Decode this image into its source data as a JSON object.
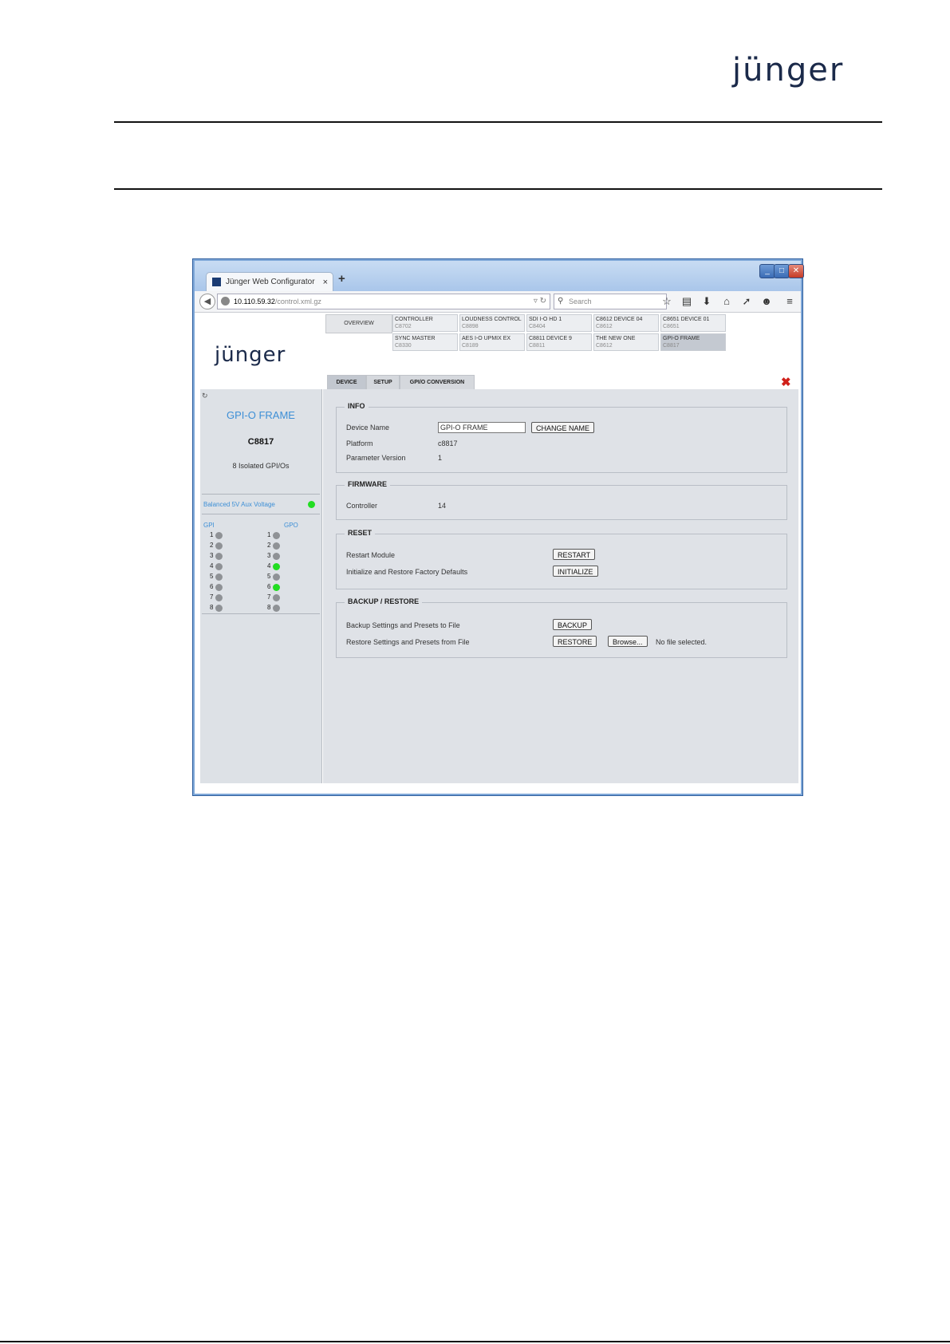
{
  "document": {
    "logo_text": "jünger"
  },
  "browser": {
    "tab_title": "Jünger Web Configurator",
    "tab_close": "×",
    "new_tab": "+",
    "url_host": "10.110.59.32",
    "url_path": "/control.xml.gz",
    "search_placeholder": "Search"
  },
  "app": {
    "logo_text": "jünger",
    "overview_label": "OVERVIEW",
    "devices": [
      {
        "name": "CONTROLLER",
        "code": "C8702"
      },
      {
        "name": "LOUDNESS CONTROL",
        "code": "C8898"
      },
      {
        "name": "SDI I-O HD 1",
        "code": "C8404"
      },
      {
        "name": "C8612 DEVICE 04",
        "code": "C8612"
      },
      {
        "name": "C8651 DEVICE 01",
        "code": "C8651"
      },
      {
        "name": "SYNC MASTER",
        "code": "C8330"
      },
      {
        "name": "AES I-O UPMIX EX",
        "code": "C8189"
      },
      {
        "name": "C8811 DEVICE 9",
        "code": "C8811"
      },
      {
        "name": "THE NEW ONE",
        "code": "C8612"
      },
      {
        "name": "GPI-O FRAME",
        "code": "C8817"
      }
    ],
    "tabs": [
      "DEVICE",
      "SETUP",
      "GPI/O CONVERSION"
    ],
    "sidebar": {
      "title": "GPI-O FRAME",
      "code": "C8817",
      "description": "8 Isolated GPI/Os",
      "aux_label": "Balanced 5V Aux Voltage",
      "aux_on": true,
      "gpi_header": "GPI",
      "gpo_header": "GPO",
      "gpi": [
        {
          "n": "1",
          "on": false
        },
        {
          "n": "2",
          "on": false
        },
        {
          "n": "3",
          "on": false
        },
        {
          "n": "4",
          "on": false
        },
        {
          "n": "5",
          "on": false
        },
        {
          "n": "6",
          "on": false
        },
        {
          "n": "7",
          "on": false
        },
        {
          "n": "8",
          "on": false
        }
      ],
      "gpo": [
        {
          "n": "1",
          "on": false
        },
        {
          "n": "2",
          "on": false
        },
        {
          "n": "3",
          "on": false
        },
        {
          "n": "4",
          "on": true
        },
        {
          "n": "5",
          "on": false
        },
        {
          "n": "6",
          "on": true
        },
        {
          "n": "7",
          "on": false
        },
        {
          "n": "8",
          "on": false
        }
      ]
    },
    "info": {
      "legend": "INFO",
      "device_name_label": "Device Name",
      "device_name_value": "GPI-O FRAME",
      "change_name_button": "CHANGE NAME",
      "platform_label": "Platform",
      "platform_value": "c8817",
      "param_version_label": "Parameter Version",
      "param_version_value": "1"
    },
    "firmware": {
      "legend": "FIRMWARE",
      "controller_label": "Controller",
      "controller_value": "14"
    },
    "reset": {
      "legend": "RESET",
      "restart_label": "Restart Module",
      "restart_button": "RESTART",
      "init_label": "Initialize and Restore Factory Defaults",
      "init_button": "INITIALIZE"
    },
    "backup": {
      "legend": "BACKUP / RESTORE",
      "backup_label": "Backup Settings and Presets to File",
      "backup_button": "BACKUP",
      "restore_label": "Restore Settings and Presets from File",
      "restore_button": "RESTORE",
      "browse_button": "Browse...",
      "file_status": "No file selected."
    }
  }
}
